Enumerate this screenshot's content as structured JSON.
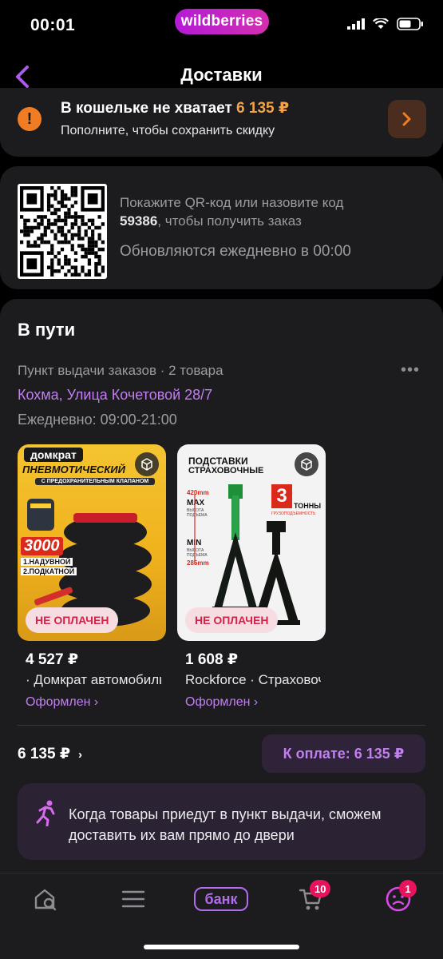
{
  "status_bar": {
    "time": "00:01",
    "brand": "wildberries"
  },
  "header": {
    "title": "Доставки"
  },
  "wallet": {
    "title": "В кошельке не хватает",
    "amount": "6 135 ₽",
    "subtitle": "Пополните, чтобы сохранить скидку"
  },
  "qr": {
    "instruction": "Покажите QR-код или назовите код",
    "code": "59386",
    "instruction_tail": ", чтобы получить заказ",
    "update_note": "Обновляются ежедневно в 00:00"
  },
  "orders": {
    "section_title": "В пути",
    "pickup_label": "Пункт выдачи заказов · 2 товара",
    "address": "Кохма, Улица Кочетовой 28/7",
    "hours": "Ежедневно: 09:00-21:00",
    "products": [
      {
        "price": "4 527 ₽",
        "name": "· Домкрат автомобильный",
        "status": "Оформлен ›",
        "badge": "НЕ ОПЛАЧЕН",
        "img_top": "Домкрат",
        "img_title": "ПНЕВМОТИЧЕСКИЙ",
        "img_sub": "С ПРЕДОХРАНИТЕЛЬНЫМ КЛАПАНОМ",
        "img_load": "3000",
        "img_list1": "1.НАДУВНОЙ",
        "img_list2": "2.ПОДКАТНОЙ"
      },
      {
        "price": "1 608 ₽",
        "name": "Rockforce · Страховочные",
        "status": "Оформлен ›",
        "badge": "НЕ ОПЛАЧЕН",
        "img_title1": "ПОДСТАВКИ",
        "img_title2": "СТРАХОВОЧНЫЕ",
        "img_max": "420mm",
        "img_max_label": "MAX",
        "img_max_sub": "ВЫСОТА ПОДЪЕМА",
        "img_min": "285mm",
        "img_min_label": "MIN",
        "img_min_sub": "ВЫСОТА ПОДЪЕМА",
        "img_tons_num": "3",
        "img_tons": "ТОННЫ",
        "img_tons_sub": "ГРУЗОПОДЪЕМНОСТЬ"
      }
    ],
    "total": "6 135 ₽",
    "pay_button": "К оплате: 6 135 ₽",
    "delivery_text": "Когда товары приедут в пункт выдачи, сможем доставить их вам прямо до двери"
  },
  "tab_bar": {
    "bank_label": "банк",
    "cart_count": "10",
    "profile_count": "1"
  },
  "colors": {
    "accent": "#c17ff0",
    "warning": "#f07c23",
    "unpaid": "#d4234b",
    "badge": "#e8135c"
  },
  "icons": [
    "back-arrow-icon",
    "warning-icon",
    "chevron-right-icon",
    "qr-code",
    "cube-icon",
    "runner-icon",
    "home-search-icon",
    "menu-icon",
    "cart-icon",
    "profile-icon",
    "signal-icon",
    "wifi-icon",
    "battery-icon"
  ]
}
